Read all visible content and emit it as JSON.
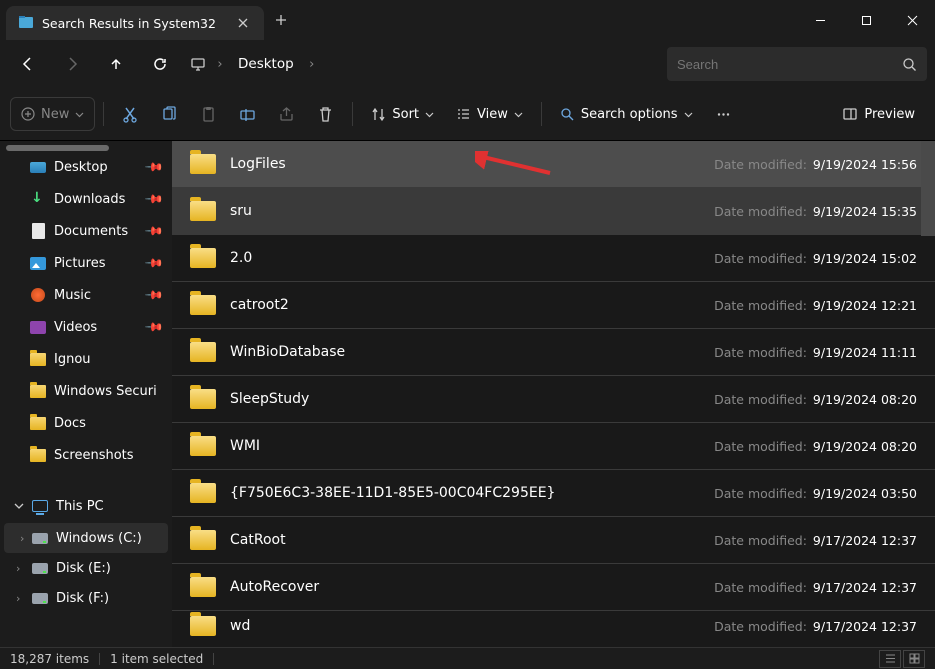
{
  "window": {
    "tab_title": "Search Results in System32"
  },
  "nav": {
    "breadcrumb": "Desktop"
  },
  "search": {
    "placeholder": "Search"
  },
  "toolbar": {
    "new_label": "New",
    "sort_label": "Sort",
    "view_label": "View",
    "search_options_label": "Search options",
    "preview_label": "Preview"
  },
  "sidebar": {
    "quick": [
      {
        "label": "Desktop",
        "icon": "desktop",
        "pinned": true
      },
      {
        "label": "Downloads",
        "icon": "download",
        "pinned": true
      },
      {
        "label": "Documents",
        "icon": "file",
        "pinned": true
      },
      {
        "label": "Pictures",
        "icon": "picture",
        "pinned": true
      },
      {
        "label": "Music",
        "icon": "music",
        "pinned": true
      },
      {
        "label": "Videos",
        "icon": "video",
        "pinned": true
      },
      {
        "label": "Ignou",
        "icon": "folder",
        "pinned": false
      },
      {
        "label": "Windows Securi",
        "icon": "folder",
        "pinned": false
      },
      {
        "label": "Docs",
        "icon": "folder",
        "pinned": false
      },
      {
        "label": "Screenshots",
        "icon": "folder",
        "pinned": false
      }
    ],
    "this_pc_label": "This PC",
    "drives": [
      {
        "label": "Windows (C:)",
        "selected": true
      },
      {
        "label": "Disk (E:)",
        "selected": false
      },
      {
        "label": "Disk (F:)",
        "selected": false
      }
    ]
  },
  "files": {
    "meta_label": "Date modified:",
    "rows": [
      {
        "name": "LogFiles",
        "date": "9/19/2024 15:56",
        "state": "selected"
      },
      {
        "name": "sru",
        "date": "9/19/2024 15:35",
        "state": "highlighted"
      },
      {
        "name": "2.0",
        "date": "9/19/2024 15:02",
        "state": ""
      },
      {
        "name": "catroot2",
        "date": "9/19/2024 12:21",
        "state": ""
      },
      {
        "name": "WinBioDatabase",
        "date": "9/19/2024 11:11",
        "state": ""
      },
      {
        "name": "SleepStudy",
        "date": "9/19/2024 08:20",
        "state": ""
      },
      {
        "name": "WMI",
        "date": "9/19/2024 08:20",
        "state": ""
      },
      {
        "name": "{F750E6C3-38EE-11D1-85E5-00C04FC295EE}",
        "date": "9/19/2024 03:50",
        "state": ""
      },
      {
        "name": "CatRoot",
        "date": "9/17/2024 12:37",
        "state": ""
      },
      {
        "name": "AutoRecover",
        "date": "9/17/2024 12:37",
        "state": ""
      },
      {
        "name": "wd",
        "date": "9/17/2024 12:37",
        "state": ""
      }
    ]
  },
  "status": {
    "item_count": "18,287 items",
    "selection": "1 item selected"
  }
}
